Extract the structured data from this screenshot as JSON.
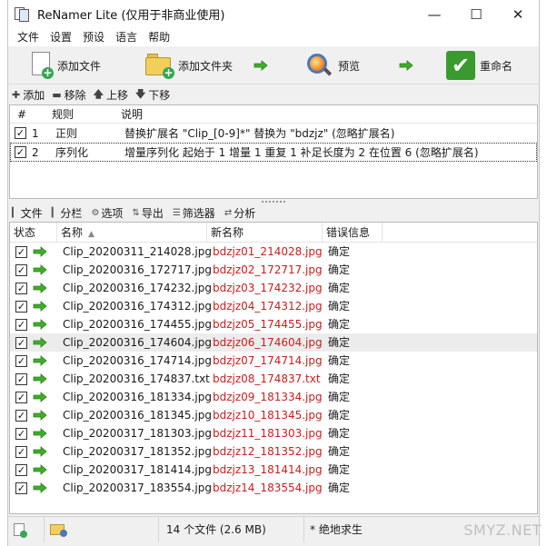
{
  "window": {
    "title": "ReNamer Lite  (仅用于非商业使用)",
    "controls": [
      "minimize-icon",
      "maximize-icon",
      "close-icon"
    ]
  },
  "menu": [
    "文件",
    "设置",
    "预设",
    "语言",
    "帮助"
  ],
  "toolbar": {
    "add_files": "添加文件",
    "add_folder": "添加文件夹",
    "preview": "预览",
    "rename": "重命名"
  },
  "rules_toolbar": {
    "add": "添加",
    "remove": "移除",
    "up": "上移",
    "down": "下移"
  },
  "rules_table": {
    "headers": [
      "#",
      "规则",
      "说明"
    ],
    "rows": [
      {
        "checked": true,
        "index": "1",
        "rule": "正则",
        "desc": "替换扩展名 \"Clip_[0-9]*\" 替换为 \"bdzjz\" (忽略扩展名)"
      },
      {
        "checked": true,
        "index": "2",
        "rule": "序列化",
        "desc": "增量序列化 起始于 1 增量 1 重复 1 补足长度为 2 在位置 6 (忽略扩展名)"
      }
    ]
  },
  "files_toolbar": {
    "files": "文件",
    "columns": "分栏",
    "options": "选项",
    "export": "导出",
    "filters": "筛选器",
    "analyze": "分析"
  },
  "files_table": {
    "headers": {
      "status": "状态",
      "name": "名称",
      "new_name": "新名称",
      "error": "错误信息"
    },
    "rows": [
      {
        "name": "Clip_20200311_214028.jpg",
        "new_name": "bdzjz01_214028.jpg",
        "error": "确定",
        "checked": true
      },
      {
        "name": "Clip_20200316_172717.jpg",
        "new_name": "bdzjz02_172717.jpg",
        "error": "确定",
        "checked": true
      },
      {
        "name": "Clip_20200316_174232.jpg",
        "new_name": "bdzjz03_174232.jpg",
        "error": "确定",
        "checked": true
      },
      {
        "name": "Clip_20200316_174312.jpg",
        "new_name": "bdzjz04_174312.jpg",
        "error": "确定",
        "checked": true
      },
      {
        "name": "Clip_20200316_174455.jpg",
        "new_name": "bdzjz05_174455.jpg",
        "error": "确定",
        "checked": true
      },
      {
        "name": "Clip_20200316_174604.jpg",
        "new_name": "bdzjz06_174604.jpg",
        "error": "确定",
        "checked": true,
        "highlighted": true
      },
      {
        "name": "Clip_20200316_174714.jpg",
        "new_name": "bdzjz07_174714.jpg",
        "error": "确定",
        "checked": true
      },
      {
        "name": "Clip_20200316_174837.txt",
        "new_name": "bdzjz08_174837.txt",
        "error": "确定",
        "checked": true
      },
      {
        "name": "Clip_20200316_181334.jpg",
        "new_name": "bdzjz09_181334.jpg",
        "error": "确定",
        "checked": true
      },
      {
        "name": "Clip_20200316_181345.jpg",
        "new_name": "bdzjz10_181345.jpg",
        "error": "确定",
        "checked": true
      },
      {
        "name": "Clip_20200317_181303.jpg",
        "new_name": "bdzjz11_181303.jpg",
        "error": "确定",
        "checked": true
      },
      {
        "name": "Clip_20200317_181352.jpg",
        "new_name": "bdzjz12_181352.jpg",
        "error": "确定",
        "checked": true
      },
      {
        "name": "Clip_20200317_181414.jpg",
        "new_name": "bdzjz13_181414.jpg",
        "error": "确定",
        "checked": true
      },
      {
        "name": "Clip_20200317_183554.jpg",
        "new_name": "bdzjz14_183554.jpg",
        "error": "确定",
        "checked": true
      }
    ]
  },
  "statusbar": {
    "file_count": "14 个文件 (2.6 MB)",
    "note": "* 绝地求生"
  },
  "watermark": "SMYZ.NET",
  "colors": {
    "new_name_text": "#c51f1f",
    "ok_arrow": "#3fae2a",
    "rename_button": "#3a9a2f"
  }
}
